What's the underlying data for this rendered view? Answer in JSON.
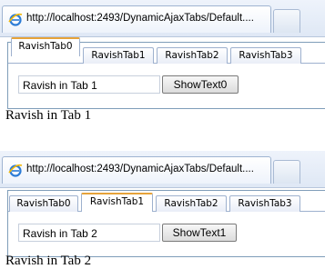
{
  "browser": {
    "tab_title": "http://localhost:2493/DynamicAjaxTabs/Default...."
  },
  "tabs": [
    "RavishTab0",
    "RavishTab1",
    "RavishTab2",
    "RavishTab3"
  ],
  "instance1": {
    "active_tab": "RavishTab0",
    "textbox_value": "Ravish in Tab 1",
    "button_label": "ShowText0",
    "result_text": "Ravish in Tab 1"
  },
  "instance2": {
    "active_tab": "RavishTab1",
    "textbox_value": "Ravish in Tab 2",
    "button_label": "ShowText1",
    "result_text": "Ravish in Tab 2"
  },
  "icons": {
    "browser_favicon": "ie-icon"
  },
  "colors": {
    "active_tab_accent": "#e6a33a",
    "tab_border": "#9eb1ce"
  }
}
